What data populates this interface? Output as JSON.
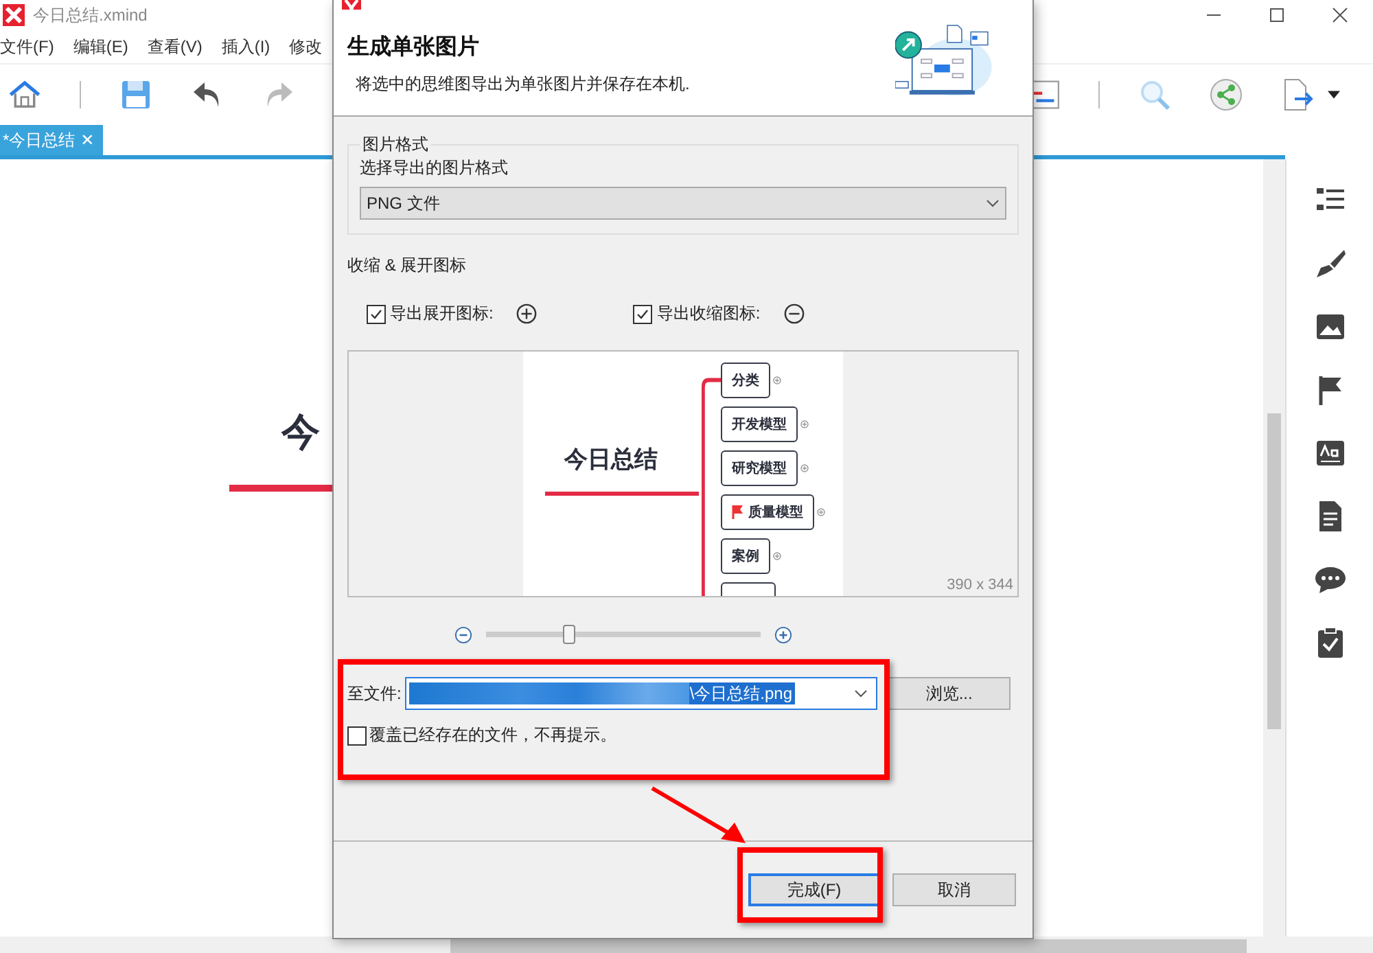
{
  "app": {
    "title": "今日总结.xmind",
    "menus": [
      "文件(F)",
      "编辑(E)",
      "查看(V)",
      "插入(I)",
      "修改"
    ],
    "tab": {
      "label": "*今日总结",
      "close": "✕",
      "selected": true
    },
    "canvas": {
      "topic": "今"
    }
  },
  "dialog": {
    "heading": "生成单张图片",
    "description": "将选中的思维图导出为单张图片并保存在本机.",
    "format_group": {
      "legend": "图片格式",
      "label": "选择导出的图片格式",
      "value": "PNG 文件"
    },
    "icons_section": {
      "label": "收缩 & 展开图标",
      "options": [
        {
          "label": "导出展开图标:",
          "checked": true,
          "kind": "expand"
        },
        {
          "label": "导出收缩图标:",
          "checked": true,
          "kind": "collapse"
        }
      ]
    },
    "preview": {
      "central": "今日总结",
      "branches": [
        {
          "label": "分类",
          "flag": false
        },
        {
          "label": "开发模型",
          "flag": false
        },
        {
          "label": "研究模型",
          "flag": false
        },
        {
          "label": "质量模型",
          "flag": true
        },
        {
          "label": "案例",
          "flag": false
        }
      ],
      "size": "390 x 344"
    },
    "zoom": {
      "level": 0.3
    },
    "file": {
      "label": "至文件:",
      "value": "\\今日总结.png",
      "browse": "浏览..."
    },
    "overwrite": {
      "label": "覆盖已经存在的文件，不再提示。",
      "checked": false
    },
    "buttons": [
      {
        "label": "完成(F)",
        "default": true
      },
      {
        "label": "取消",
        "default": false
      }
    ]
  }
}
